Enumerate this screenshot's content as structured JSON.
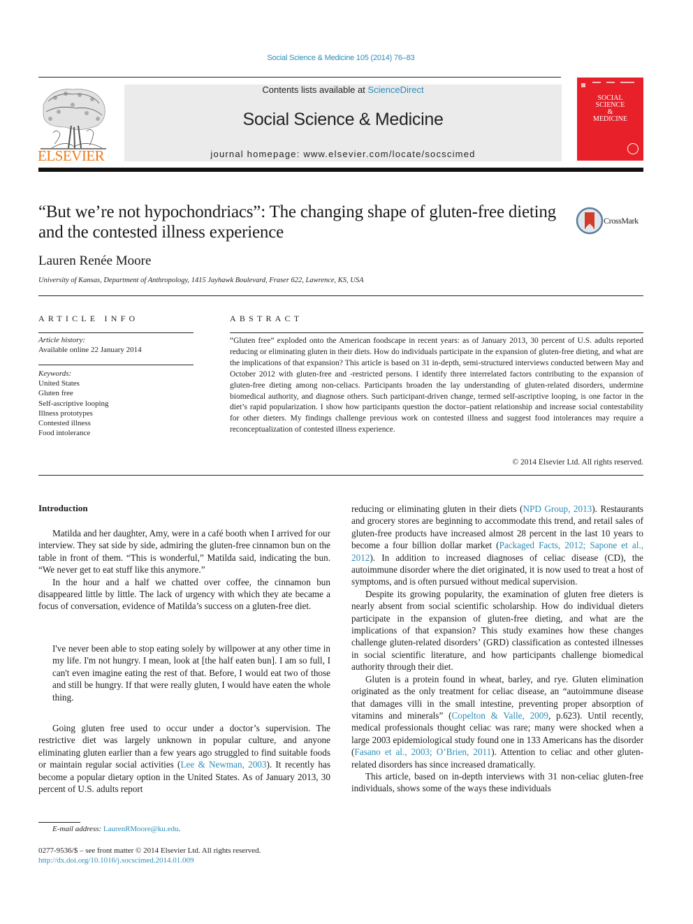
{
  "journal_citation": "Social Science & Medicine 105 (2014) 76–83",
  "header": {
    "contents_prefix": "Contents lists available at ",
    "contents_link": "ScienceDirect",
    "journal_name": "Social Science & Medicine",
    "homepage_prefix": "journal homepage: ",
    "homepage_url": "www.elsevier.com/locate/socscimed",
    "publisher_logo_text": "ELSEVIER",
    "cover_lines": [
      "SOCIAL",
      "SCIENCE",
      "&",
      "MEDICINE"
    ],
    "colors": {
      "publisher_orange": "#f07a16",
      "cover_red": "#e8202a",
      "link_blue": "#2a8db8"
    }
  },
  "article": {
    "title": "“But we’re not hypochondriacs”: The changing shape of gluten-free dieting and the contested illness experience",
    "crossmark_label": "CrossMark",
    "author": "Lauren Renée Moore",
    "affiliation": "University of Kansas, Department of Anthropology, 1415 Jayhawk Boulevard, Fraser 622, Lawrence, KS, USA"
  },
  "article_info": {
    "heading": "ARTICLE INFO",
    "history_label": "Article history:",
    "history_value": "Available online 22 January 2014",
    "keywords_label": "Keywords:",
    "keywords": [
      "United States",
      "Gluten free",
      "Self-ascriptive looping",
      "Illness prototypes",
      "Contested illness",
      "Food intolerance"
    ]
  },
  "abstract": {
    "heading": "ABSTRACT",
    "body": "“Gluten free” exploded onto the American foodscape in recent years: as of January 2013, 30 percent of U.S. adults reported reducing or eliminating gluten in their diets. How do individuals participate in the expansion of gluten-free dieting, and what are the implications of that expansion? This article is based on 31 in-depth, semi-structured interviews conducted between May and October 2012 with gluten-free and -restricted persons. I identify three interrelated factors contributing to the expansion of gluten-free dieting among non-celiacs. Participants broaden the lay understanding of gluten-related disorders, undermine biomedical authority, and diagnose others. Such participant-driven change, termed self-ascriptive looping, is one factor in the diet’s rapid popularization. I show how participants question the doctor–patient relationship and increase social contestability for other dieters. My findings challenge previous work on contested illness and suggest food intolerances may require a reconceptualization of contested illness experience.",
    "copyright": "© 2014 Elsevier Ltd. All rights reserved."
  },
  "body": {
    "intro_heading": "Introduction",
    "left_paragraphs": [
      "Matilda and her daughter, Amy, were in a café booth when I arrived for our interview. They sat side by side, admiring the gluten-free cinnamon bun on the table in front of them. “This is wonderful,” Matilda said, indicating the bun. “We never get to eat stuff like this anymore.”",
      "In the hour and a half we chatted over coffee, the cinnamon bun disappeared little by little. The lack of urgency with which they ate became a focus of conversation, evidence of Matilda’s success on a gluten-free diet."
    ],
    "blockquote": "I've never been able to stop eating solely by willpower at any other time in my life. I'm not hungry. I mean, look at [the half eaten bun]. I am so full, I can't even imagine eating the rest of that. Before, I would eat two of those and still be hungry. If that were really gluten, I would have eaten the whole thing.",
    "left_p3": {
      "before": "Going gluten free used to occur under a doctor’s supervision. The restrictive diet was largely unknown in popular culture, and anyone eliminating gluten earlier than a few years ago struggled to find suitable foods or maintain regular social activities (",
      "cite": "Lee & Newman, 2003",
      "after": "). It recently has become a popular dietary option in the United States. As of January 2013, 30 percent of U.S. adults report"
    },
    "right_p1": {
      "t1": "reducing or eliminating gluten in their diets (",
      "c1": "NPD Group, 2013",
      "t2": "). Restaurants and grocery stores are beginning to accommodate this trend, and retail sales of gluten-free products have increased almost 28 percent in the last 10 years to become a four billion dollar market (",
      "c2": "Packaged Facts, 2012; Sapone et al., 2012",
      "t3": "). In addition to increased diagnoses of celiac disease (CD), the autoimmune disorder where the diet originated, it is now used to treat a host of symptoms, and is often pursued without medical supervision."
    },
    "right_p2": "Despite its growing popularity, the examination of gluten free dieters is nearly absent from social scientific scholarship. How do individual dieters participate in the expansion of gluten-free dieting, and what are the implications of that expansion? This study examines how these changes challenge gluten-related disorders’ (GRD) classification as contested illnesses in social scientific literature, and how participants challenge biomedical authority through their diet.",
    "right_p3": {
      "t1": "Gluten is a protein found in wheat, barley, and rye. Gluten elimination originated as the only treatment for celiac disease, an “autoimmune disease that damages villi in the small intestine, preventing proper absorption of vitamins and minerals” (",
      "c1": "Copelton & Valle, 2009",
      "t2": ", p.623). Until recently, medical professionals thought celiac was rare; many were shocked when a large 2003 epidemiological study found one in 133 Americans has the disorder (",
      "c2": "Fasano et al., 2003; O’Brien, 2011",
      "t3": "). Attention to celiac and other gluten-related disorders has since increased dramatically."
    },
    "right_p4": "This article, based on in-depth interviews with 31 non-celiac gluten-free individuals, shows some of the ways these individuals"
  },
  "footnotes": {
    "email_label": "E-mail address:",
    "email": "LaurenRMoore@ku.edu",
    "email_suffix": ".",
    "front_matter": "0277-9536/$ – see front matter © 2014 Elsevier Ltd. All rights reserved.",
    "doi": "http://dx.doi.org/10.1016/j.socscimed.2014.01.009"
  }
}
